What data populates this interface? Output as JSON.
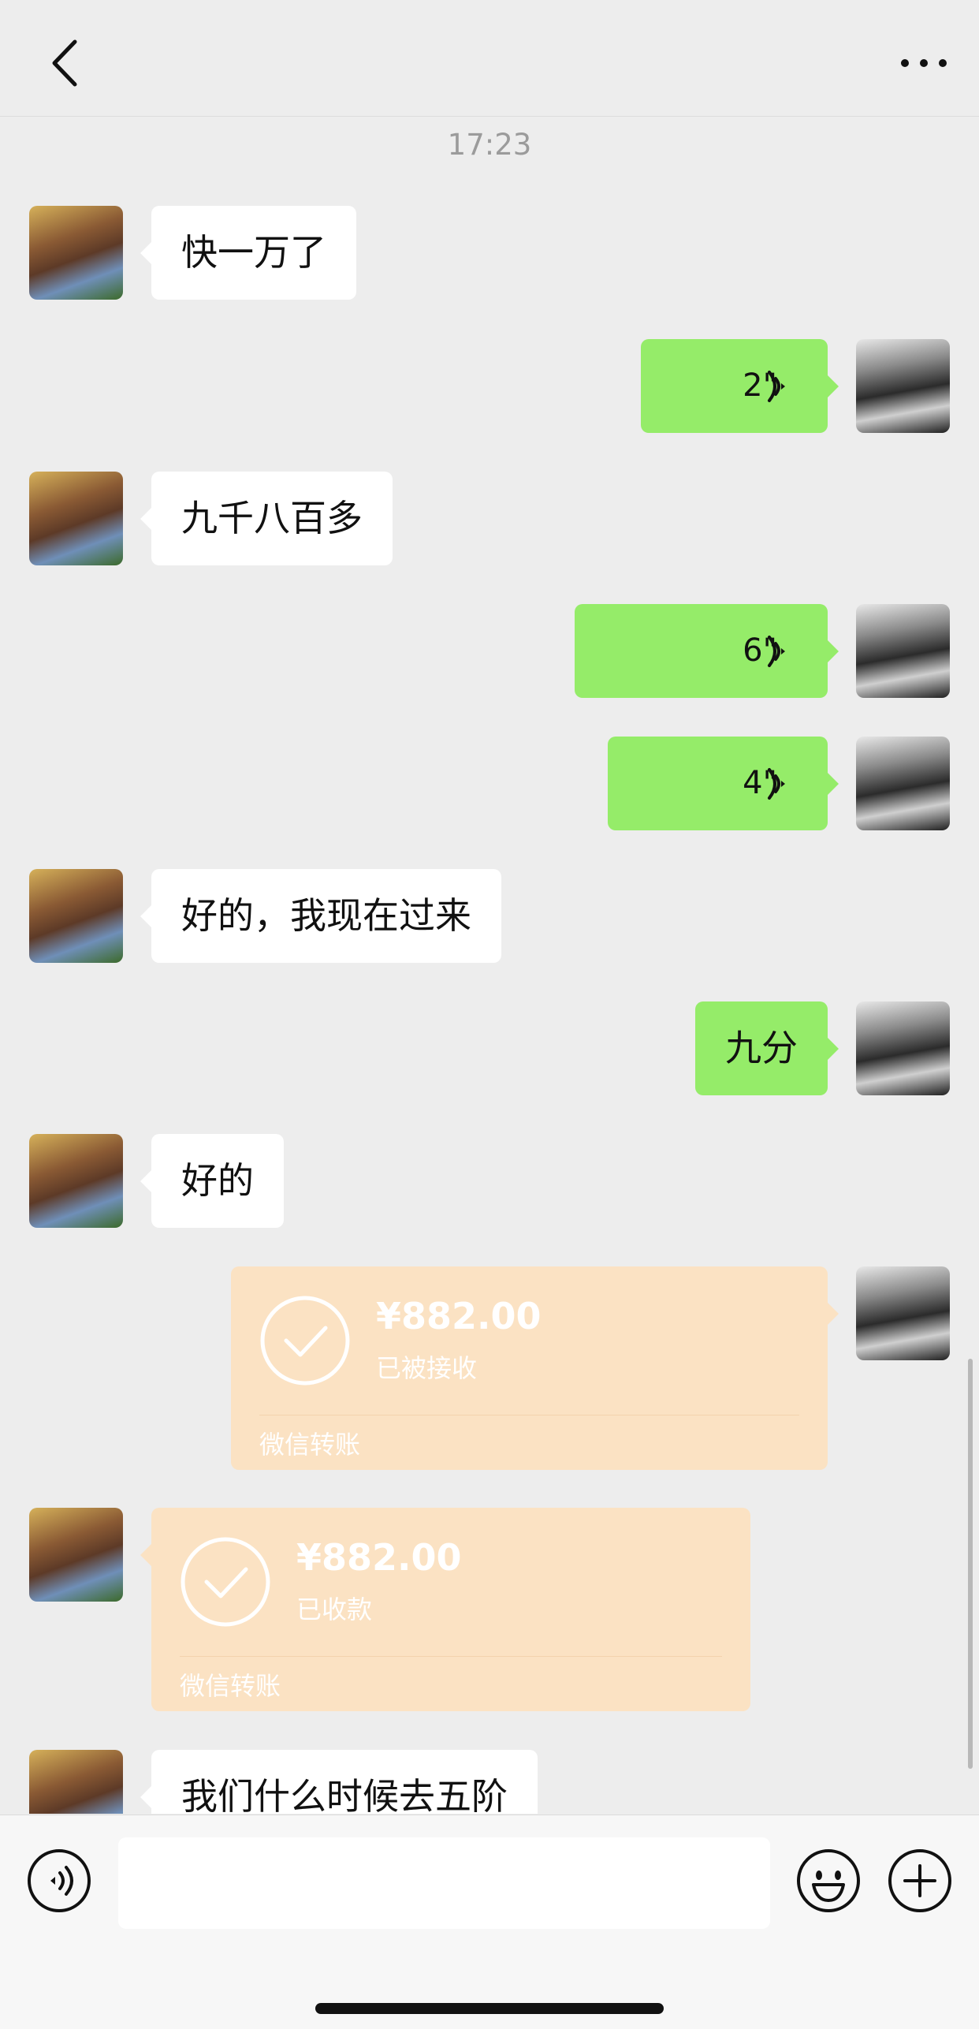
{
  "header": {
    "title": "",
    "back_icon": "chevron-left-icon",
    "more_icon": "more-dots-icon"
  },
  "chat": {
    "timestamp": "17:23",
    "messages": [
      {
        "from": "friend",
        "type": "text",
        "text": "快一万了"
      },
      {
        "from": "me",
        "type": "voice",
        "duration": "2\""
      },
      {
        "from": "friend",
        "type": "text",
        "text": "九千八百多"
      },
      {
        "from": "me",
        "type": "voice",
        "duration": "6\""
      },
      {
        "from": "me",
        "type": "voice",
        "duration": "4\""
      },
      {
        "from": "friend",
        "type": "text",
        "text": "好的，我现在过来"
      },
      {
        "from": "me",
        "type": "text",
        "text": "九分"
      },
      {
        "from": "friend",
        "type": "text",
        "text": "好的"
      },
      {
        "from": "me",
        "type": "transfer",
        "amount": "¥882.00",
        "status": "已被接收",
        "label": "微信转账"
      },
      {
        "from": "friend",
        "type": "transfer",
        "amount": "¥882.00",
        "status": "已收款",
        "label": "微信转账"
      },
      {
        "from": "friend",
        "type": "text",
        "text": "我们什么时候去五阶"
      }
    ]
  },
  "input_bar": {
    "voice_icon": "voice-mode-icon",
    "input_value": "",
    "emoji_icon": "emoji-icon",
    "plus_icon": "plus-icon"
  },
  "colors": {
    "background": "#ededed",
    "my_bubble": "#95ec69",
    "friend_bubble": "#ffffff",
    "transfer_card": "#fbe2c3"
  }
}
